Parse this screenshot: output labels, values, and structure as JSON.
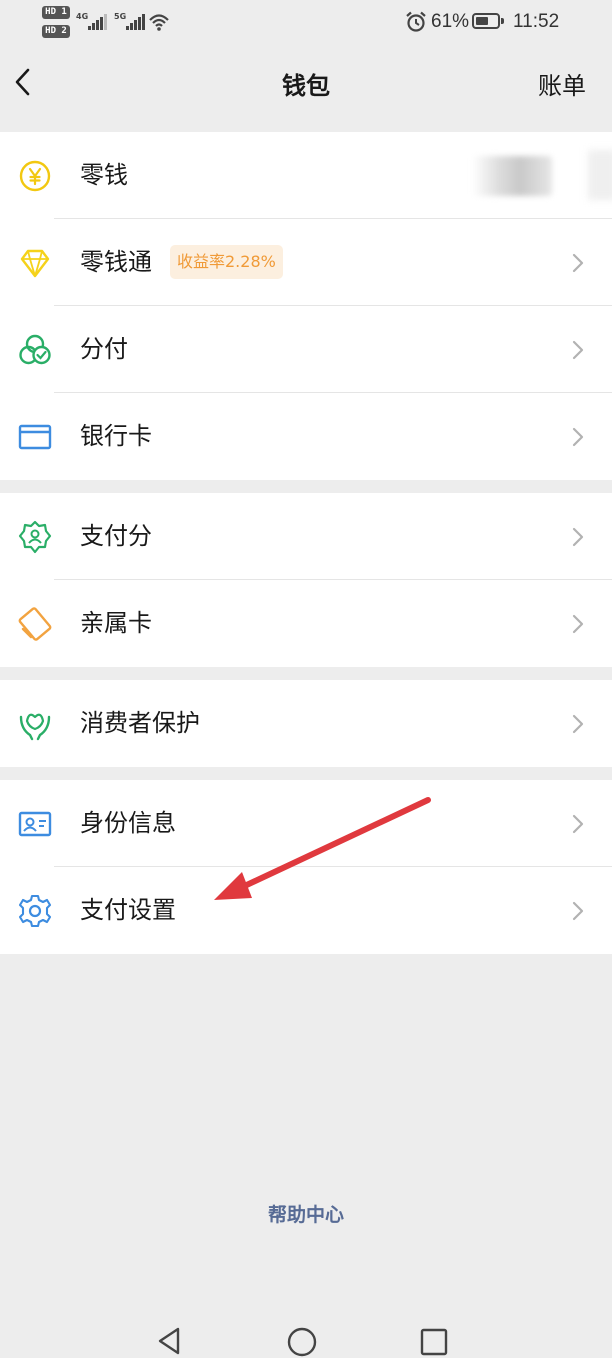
{
  "status_bar": {
    "hd1": "HD 1",
    "hd2": "HD 2",
    "network1": "4G",
    "network2": "5G",
    "battery_percent": "61%",
    "battery_level": 0.61,
    "time": "11:52"
  },
  "navbar": {
    "title": "钱包",
    "right_action": "账单"
  },
  "groups": [
    {
      "items": [
        {
          "label": "零钱",
          "icon": "coin-yuan-icon",
          "color": "#f2c811"
        },
        {
          "label": "零钱通",
          "icon": "diamond-icon",
          "color": "#f5d21a",
          "badge": "收益率2.28%"
        },
        {
          "label": "分付",
          "icon": "fenfu-icon",
          "color": "#2aae67"
        },
        {
          "label": "银行卡",
          "icon": "card-icon",
          "color": "#3d8ce0"
        }
      ]
    },
    {
      "items": [
        {
          "label": "支付分",
          "icon": "score-badge-icon",
          "color": "#2aae67"
        },
        {
          "label": "亲属卡",
          "icon": "family-card-icon",
          "color": "#f2a340"
        }
      ]
    },
    {
      "items": [
        {
          "label": "消费者保护",
          "icon": "protect-hands-icon",
          "color": "#2aae67"
        }
      ]
    },
    {
      "items": [
        {
          "label": "身份信息",
          "icon": "id-card-icon",
          "color": "#3d8ce0"
        },
        {
          "label": "支付设置",
          "icon": "gear-icon",
          "color": "#3d8ce0"
        }
      ]
    }
  ],
  "footer": {
    "help_link": "帮助中心",
    "help_color": "#576b95"
  },
  "annotation": {
    "arrow_color": "#e0393e"
  }
}
